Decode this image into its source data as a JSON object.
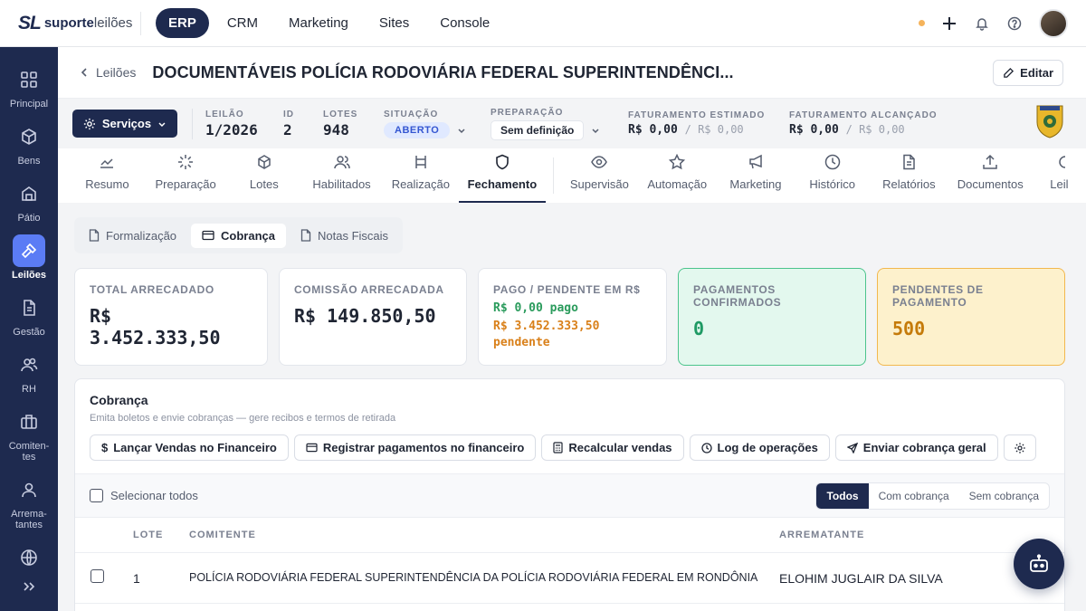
{
  "topbar": {
    "logo_mark": "SL",
    "logo_bold": "suporte",
    "logo_light": "leilões",
    "nav": [
      "ERP",
      "CRM",
      "Marketing",
      "Sites",
      "Console"
    ],
    "active_nav": "ERP",
    "status_dot_color": "#f5b35b"
  },
  "sidebar": {
    "items": [
      {
        "label": "Principal",
        "icon": "grid-icon"
      },
      {
        "label": "Bens",
        "icon": "box-icon"
      },
      {
        "label": "Pátio",
        "icon": "warehouse-icon"
      },
      {
        "label": "Leilões",
        "icon": "gavel-icon",
        "active": true
      },
      {
        "label": "Gestão",
        "icon": "document-icon"
      },
      {
        "label": "RH",
        "icon": "users-icon"
      },
      {
        "label": "Comiten-\ntes",
        "icon": "briefcase-icon"
      },
      {
        "label": "Arrema-\ntantes",
        "icon": "user-icon"
      },
      {
        "label": "",
        "icon": "globe-icon"
      }
    ]
  },
  "header": {
    "back_label": "Leilões",
    "title": "DOCUMENTÁVEIS POLÍCIA RODOVIÁRIA FEDERAL SUPERINTENDÊNCI...",
    "edit_label": "Editar"
  },
  "info": {
    "services_label": "Serviços",
    "leilao_label": "LEILÃO",
    "leilao_value": "1/2026",
    "id_label": "ID",
    "id_value": "2",
    "lotes_label": "LOTES",
    "lotes_value": "948",
    "situacao_label": "SITUAÇÃO",
    "situacao_value": "ABERTO",
    "preparacao_label": "PREPARAÇÃO",
    "preparacao_value": "Sem definição",
    "fat_est_label": "FATURAMENTO ESTIMADO",
    "fat_est_value": "R$ 0,00",
    "fat_est_sep": "/ R$ 0,00",
    "fat_alc_label": "FATURAMENTO ALCANÇADO",
    "fat_alc_value": "R$ 0,00",
    "fat_alc_sep": "/ R$ 0,00"
  },
  "tabs": [
    {
      "label": "Resumo",
      "icon": "chart-line-icon"
    },
    {
      "label": "Preparação",
      "icon": "loader-icon"
    },
    {
      "label": "Lotes",
      "icon": "box-icon"
    },
    {
      "label": "Habilitados",
      "icon": "users-icon"
    },
    {
      "label": "Realização",
      "icon": "hammer-icon"
    },
    {
      "label": "Fechamento",
      "icon": "shield-icon",
      "active": true
    },
    {
      "label": "Supervisão",
      "icon": "eye-icon"
    },
    {
      "label": "Automação",
      "icon": "star-icon"
    },
    {
      "label": "Marketing",
      "icon": "megaphone-icon"
    },
    {
      "label": "Histórico",
      "icon": "clock-icon"
    },
    {
      "label": "Relatórios",
      "icon": "file-text-icon"
    },
    {
      "label": "Documentos",
      "icon": "upload-icon"
    },
    {
      "label": "Leil",
      "icon": "partial-icon"
    }
  ],
  "subtabs": [
    {
      "label": "Formalização",
      "icon": "file-icon"
    },
    {
      "label": "Cobrança",
      "icon": "credit-card-icon",
      "active": true
    },
    {
      "label": "Notas Fiscais",
      "icon": "file-icon"
    }
  ],
  "cards": {
    "total_label": "TOTAL ARRECADADO",
    "total_value": "R$ 3.452.333,50",
    "comissao_label": "COMISSÃO ARRECADADA",
    "comissao_value": "R$ 149.850,50",
    "pago_label": "PAGO / PENDENTE EM R$",
    "pago_value": "R$ 0,00 pago",
    "pendente_value": "R$ 3.452.333,50 pendente",
    "confirmados_label": "PAGAMENTOS CONFIRMADOS",
    "confirmados_value": "0",
    "pendentes_label": "PENDENTES DE PAGAMENTO",
    "pendentes_value": "500"
  },
  "cobranca": {
    "title": "Cobrança",
    "subtitle": "Emita boletos e envie cobranças — gere recibos e termos de retirada",
    "actions": [
      {
        "label": "Lançar Vendas no Financeiro",
        "icon": "dollar-icon"
      },
      {
        "label": "Registrar pagamentos no financeiro",
        "icon": "credit-card-icon"
      },
      {
        "label": "Recalcular vendas",
        "icon": "calculator-icon"
      },
      {
        "label": "Log de operações",
        "icon": "clock-icon"
      },
      {
        "label": "Enviar cobrança geral",
        "icon": "send-icon"
      }
    ],
    "select_all": "Selecionar todos",
    "filters": [
      "Todos",
      "Com cobrança",
      "Sem cobrança"
    ],
    "active_filter": "Todos",
    "columns": [
      "LOTE",
      "COMITENTE",
      "ARREMATANTE"
    ],
    "rows": [
      {
        "lote": "1",
        "comitente": "POLÍCIA RODOVIÁRIA FEDERAL SUPERINTENDÊNCIA DA POLÍCIA RODOVIÁRIA FEDERAL EM RONDÔNIA",
        "arrematante": "ELOHIM JUGLAIR DA SILVA"
      }
    ]
  },
  "colors": {
    "primary": "#1e2a4f",
    "accent": "#5b7cf5",
    "success": "#1f9a64",
    "warning": "#c57b0a"
  }
}
